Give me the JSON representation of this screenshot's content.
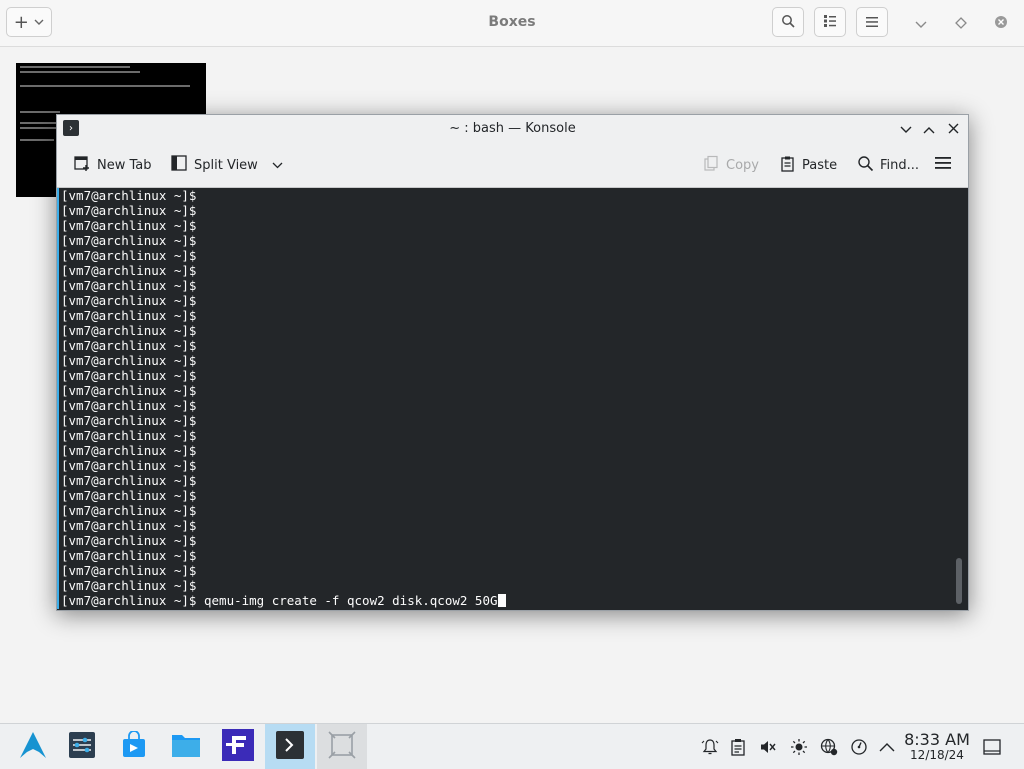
{
  "boxes": {
    "title": "Boxes",
    "add_button": "+",
    "vm_thumbnail": {
      "name": "archlinux-vm-preview"
    }
  },
  "konsole": {
    "title": "~ : bash — Konsole",
    "toolbar": {
      "new_tab": "New Tab",
      "split_view": "Split View",
      "copy": "Copy",
      "paste": "Paste",
      "find": "Find..."
    },
    "terminal": {
      "prompt": "[vm7@archlinux ~]$",
      "empty_prompt_count": 27,
      "last_command": "qemu-img create -f qcow2 disk.qcow2 50G"
    }
  },
  "taskbar": {
    "apps": [
      {
        "name": "arch-launcher-icon"
      },
      {
        "name": "system-settings-icon"
      },
      {
        "name": "discover-store-icon"
      },
      {
        "name": "file-manager-icon"
      },
      {
        "name": "app-f-icon"
      },
      {
        "name": "konsole-icon",
        "active": true
      },
      {
        "name": "boxes-icon",
        "active": true
      }
    ],
    "clock": {
      "time": "8:33 AM",
      "date": "12/18/24"
    }
  },
  "colors": {
    "accent": "#3daee9",
    "terminal_bg": "#232629",
    "terminal_fg": "#fcfcfc",
    "active_task": "#b7dcf3"
  }
}
